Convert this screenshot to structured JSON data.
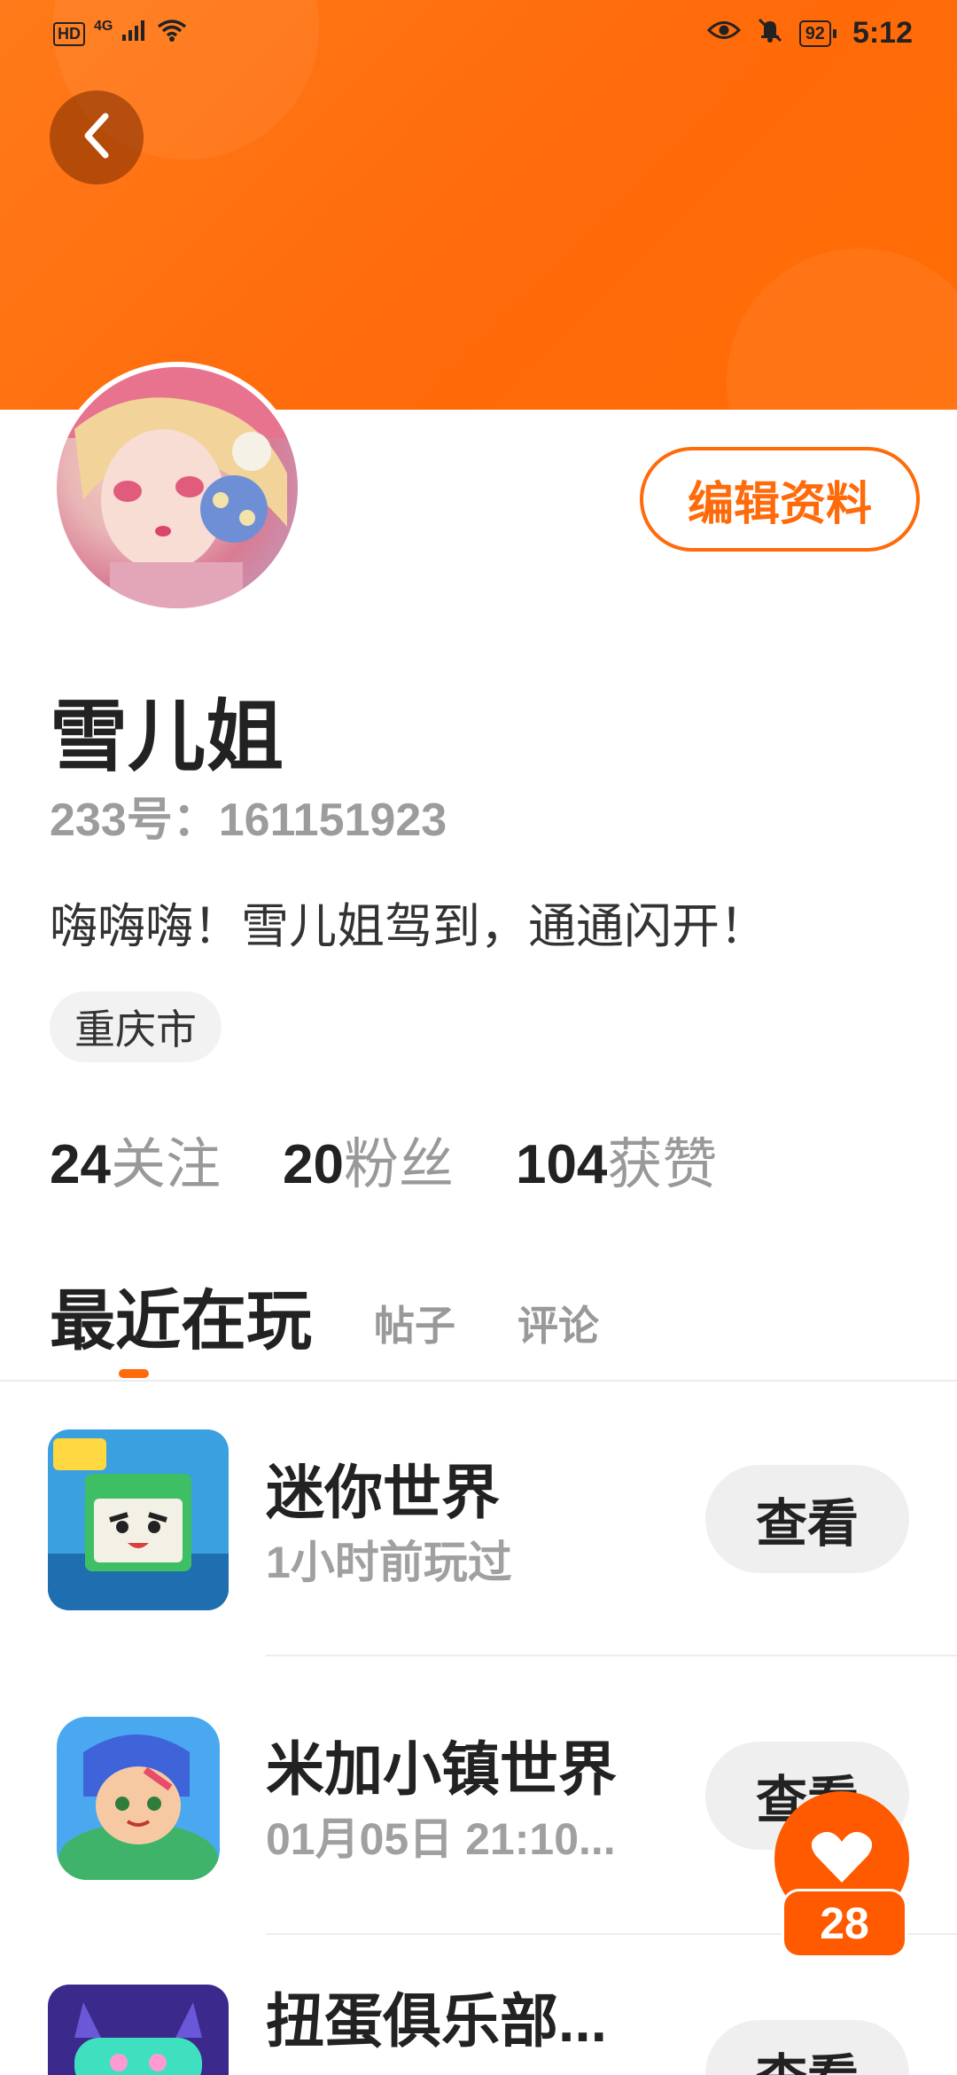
{
  "status_bar": {
    "left_badge": "HD",
    "network": "4G",
    "battery": "92",
    "time": "5:12"
  },
  "profile": {
    "edit_label": "编辑资料",
    "name": "雪儿姐",
    "uid": "233号：161151923",
    "bio": "嗨嗨嗨！雪儿姐驾到，通通闪开！",
    "location": "重庆市"
  },
  "stats": [
    {
      "num": "24",
      "label": "关注"
    },
    {
      "num": "20",
      "label": "粉丝"
    },
    {
      "num": "104",
      "label": "获赞"
    }
  ],
  "tabs": {
    "active": "最近在玩",
    "others": [
      "帖子",
      "评论"
    ]
  },
  "games": [
    {
      "title": "迷你世界",
      "subtitle": "1小时前玩过",
      "button": "查看",
      "icon": "mini-world-icon"
    },
    {
      "title": "米加小镇世界",
      "subtitle": "01月05日 21:10...",
      "button": "查看",
      "icon": "miga-town-icon"
    },
    {
      "title": "扭蛋俱乐部...",
      "subtitle": "",
      "button": "查看",
      "icon": "gacha-club-icon"
    }
  ],
  "fab": {
    "count": "28"
  },
  "colors": {
    "accent": "#ff6a0a",
    "banner": "#ff7a1a"
  }
}
